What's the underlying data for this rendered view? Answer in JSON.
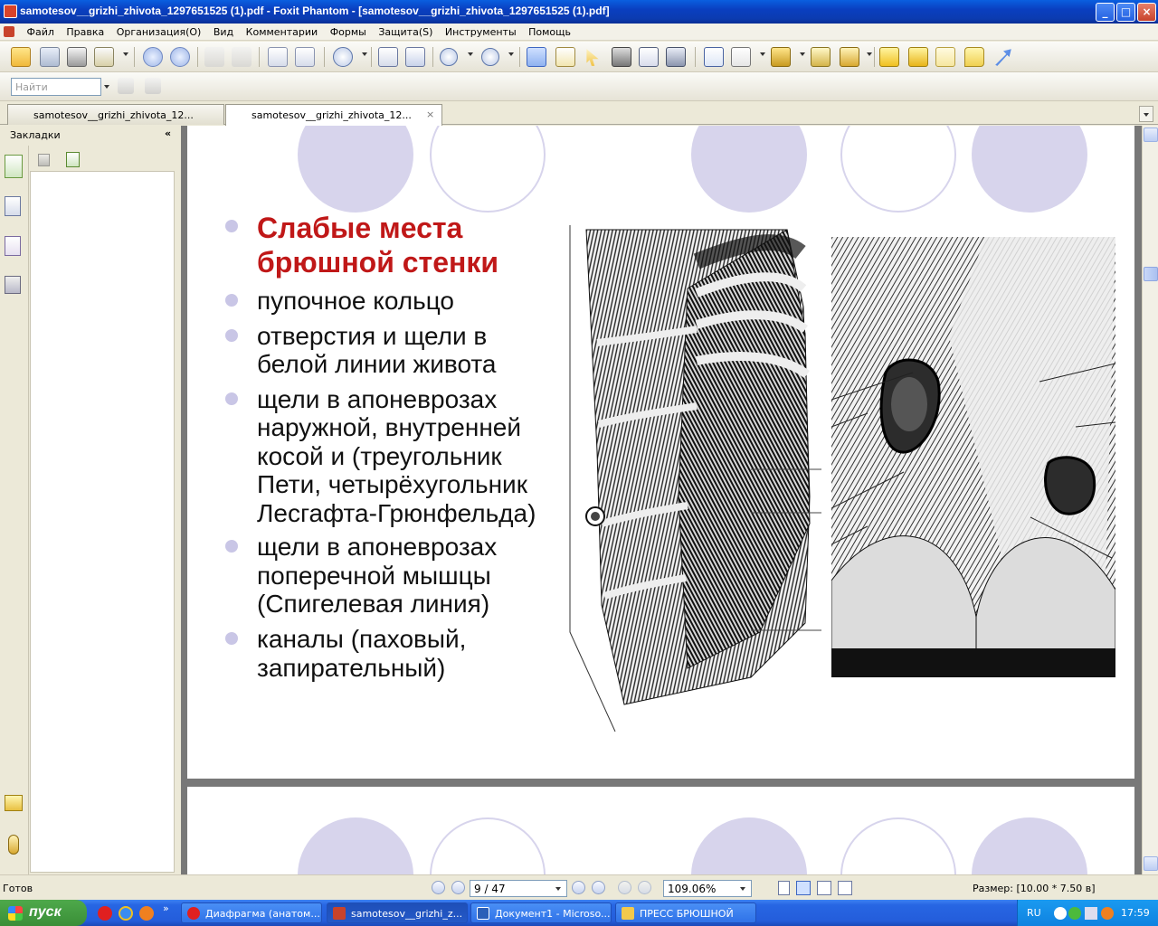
{
  "window": {
    "title": "samotesov__grizhi_zhivota_1297651525 (1).pdf - Foxit Phantom - [samotesov__grizhi_zhivota_1297651525 (1).pdf]",
    "buttons": [
      "_",
      "□",
      "×"
    ]
  },
  "menu": [
    "Файл",
    "Правка",
    "Организация(O)",
    "Вид",
    "Комментарии",
    "Формы",
    "Защита(S)",
    "Инструменты",
    "Помощь"
  ],
  "toolbar": {
    "icons": [
      "open-icon",
      "save-icon",
      "print-icon",
      "email-icon",
      "first-page-icon",
      "prev-page-icon",
      "back-icon",
      "forward-icon",
      "extract-icon",
      "insert-icon",
      "zoom-icon",
      "fit-page-icon",
      "fit-width-icon",
      "zoom-out-icon",
      "zoom-in-icon",
      "hand-icon",
      "select-text-icon",
      "select-icon",
      "binocular-icon",
      "typewriter-icon",
      "snapshot-icon",
      "rect-icon",
      "note-edit-icon",
      "stamp-icon",
      "sign-icon",
      "lock-icon",
      "highlight-icon",
      "edit-icon",
      "textbox-icon",
      "comment-icon",
      "arrow-icon"
    ]
  },
  "search": {
    "placeholder": "Найти"
  },
  "tabs": [
    {
      "label": "samotesov__grizhi_zhivota_12...",
      "active": false
    },
    {
      "label": "samotesov__grizhi_zhivota_12...",
      "active": true,
      "close": "×"
    }
  ],
  "bookmarks": {
    "title": "Закладки",
    "collapse": "«"
  },
  "slide": {
    "title_line1": "Слабые места",
    "title_line2": "брюшной стенки",
    "bullets": [
      [
        "пупочное кольцо"
      ],
      [
        "отверстия и щели в",
        "белой линии живота"
      ],
      [
        "щели в апоневрозах",
        "наружной, внутренней",
        "косой и (треугольник",
        "Пети, четырёхугольник",
        "Лесгафта-Грюнфельда)"
      ],
      [
        "щели в апоневрозах",
        "поперечной мышцы",
        "(Спигелевая линия)"
      ],
      [
        "каналы (паховый,",
        "запирательный)"
      ]
    ]
  },
  "status": {
    "ready": "Готов",
    "page": "9 / 47",
    "zoom": "109.06%",
    "size": "Размер: [10.00 * 7.50 в]"
  },
  "taskbar": {
    "start": "пуск",
    "tasks": [
      {
        "label": "Диафрагма (анатом...",
        "active": false,
        "color": "#e02020"
      },
      {
        "label": "samotesov__grizhi_z...",
        "active": true,
        "color": "#c8432b"
      },
      {
        "label": "Документ1 - Microso...",
        "active": false,
        "color": "#2b5fb8"
      },
      {
        "label": "ПРЕСС БРЮШНОЙ",
        "active": false,
        "color": "#f2c94c"
      }
    ],
    "lang": "RU",
    "time": "17:59"
  }
}
